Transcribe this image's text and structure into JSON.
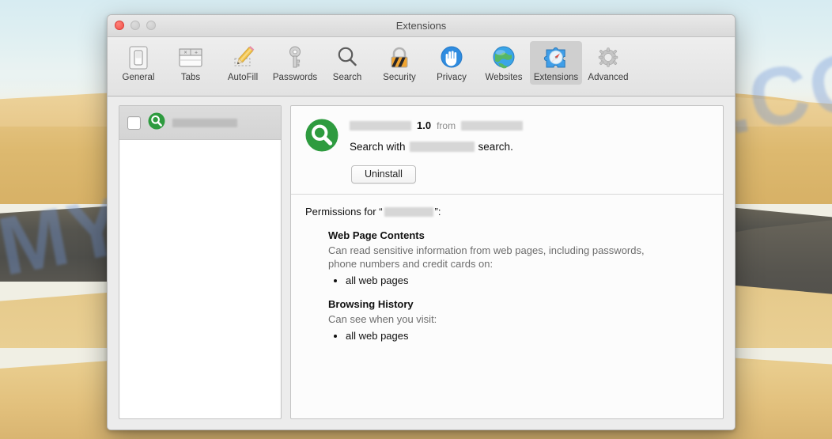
{
  "desktop": {
    "wallpaper_name": "desert-dunes-wallpaper",
    "watermark": "MYANTISPYWARE.COM",
    "watermark_color": "#7096d7"
  },
  "window": {
    "title": "Extensions",
    "traffic_lights": [
      {
        "name": "close",
        "color": "#f1534a",
        "active": true
      },
      {
        "name": "minimize",
        "color": "#c9c9c9",
        "active": false
      },
      {
        "name": "zoom",
        "color": "#c9c9c9",
        "active": false
      }
    ]
  },
  "toolbar": {
    "items": [
      {
        "label": "General",
        "icon": "light-switch-icon",
        "selected": false
      },
      {
        "label": "Tabs",
        "icon": "browser-tabs-icon",
        "selected": false
      },
      {
        "label": "AutoFill",
        "icon": "pencil-icon",
        "selected": false
      },
      {
        "label": "Passwords",
        "icon": "key-icon",
        "selected": false
      },
      {
        "label": "Search",
        "icon": "magnifier-icon",
        "selected": false
      },
      {
        "label": "Security",
        "icon": "padlock-icon",
        "selected": false
      },
      {
        "label": "Privacy",
        "icon": "hand-icon",
        "selected": false
      },
      {
        "label": "Websites",
        "icon": "globe-icon",
        "selected": false
      },
      {
        "label": "Extensions",
        "icon": "puzzle-compass-icon",
        "selected": true
      },
      {
        "label": "Advanced",
        "icon": "gear-icon",
        "selected": false
      }
    ]
  },
  "sidebar": {
    "rows": [
      {
        "icon": "green-search-extension-icon",
        "name_redacted": true,
        "name_redaction_width": 82,
        "checked": false,
        "selected": true
      }
    ]
  },
  "detail": {
    "icon": "green-search-extension-icon",
    "name_redacted": true,
    "name_redaction_width": 78,
    "version": "1.0",
    "from_label": "from",
    "publisher_redacted": true,
    "publisher_redaction_width": 78,
    "description_prefix": "Search with",
    "description_redacted": true,
    "description_redaction_width": 82,
    "description_suffix": "search.",
    "uninstall_label": "Uninstall"
  },
  "permissions": {
    "heading_prefix": "Permissions for “",
    "heading_redacted": true,
    "heading_redaction_width": 62,
    "heading_suffix": "”:",
    "groups": [
      {
        "title": "Web Page Contents",
        "description": "Can read sensitive information from web pages, including passwords, phone numbers and credit cards on:",
        "items": [
          "all web pages"
        ]
      },
      {
        "title": "Browsing History",
        "description": "Can see when you visit:",
        "items": [
          "all web pages"
        ]
      }
    ]
  }
}
